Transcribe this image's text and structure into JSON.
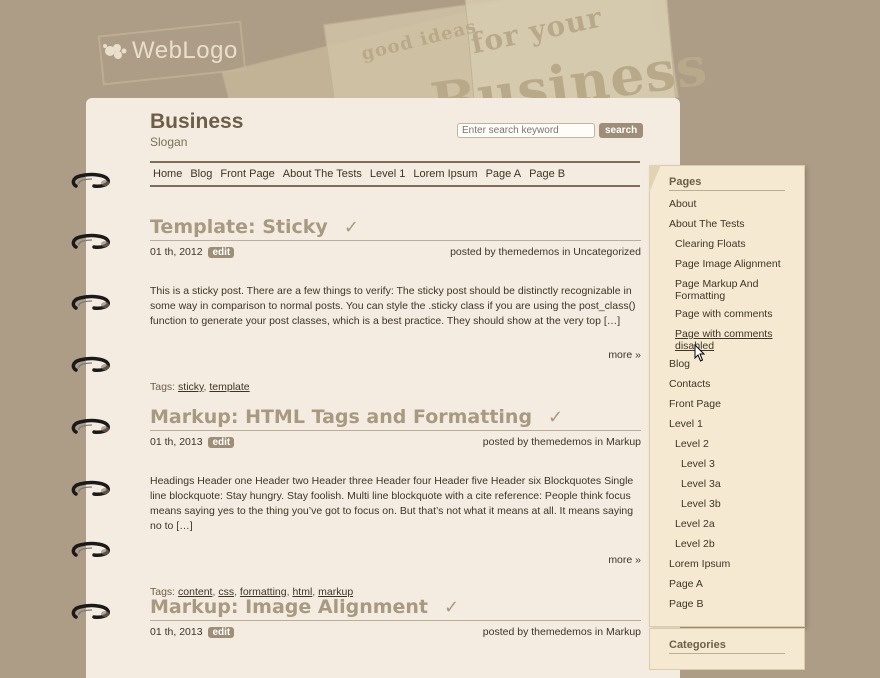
{
  "logo": {
    "text": "WebLogo"
  },
  "header_words": {
    "w1": "Business",
    "w2": "for your",
    "w3": "good ideas"
  },
  "site": {
    "title": "Business",
    "slogan": "Slogan"
  },
  "search": {
    "placeholder": "Enter search keyword",
    "button": "search"
  },
  "nav": [
    "Home",
    "Blog",
    "Front Page",
    "About The Tests",
    "Level 1",
    "Lorem Ipsum",
    "Page A",
    "Page B"
  ],
  "common": {
    "edit": "edit",
    "posted_by": "posted by",
    "in": "in",
    "more": "more »",
    "tags_label": "Tags:"
  },
  "posts": [
    {
      "title": "Template: Sticky",
      "date": "01 th, 2012",
      "author": "themedemos",
      "category": "Uncategorized",
      "excerpt": "This is a sticky post. There are a few things to verify: The sticky post should be distinctly recognizable in some way in comparison to normal posts. You can style the .sticky class if you are using the post_class() function to generate your post classes, which is a best practice. They should show at the very top […]",
      "tags": [
        "sticky",
        "template"
      ]
    },
    {
      "title": "Markup: HTML Tags and Formatting",
      "date": "01 th, 2013",
      "author": "themedemos",
      "category": "Markup",
      "excerpt": "Headings Header one Header two Header three Header four Header five Header six Blockquotes Single line blockquote: Stay hungry. Stay foolish. Multi line blockquote with a cite reference: People think focus means saying yes to the thing you’ve got to focus on. But that’s not what it means at all. It means saying no to […]",
      "tags": [
        "content",
        "css",
        "formatting",
        "html",
        "markup"
      ]
    },
    {
      "title": "Markup: Image Alignment",
      "date": "01 th, 2013",
      "author": "themedemos",
      "category": "Markup"
    }
  ],
  "sidebar": {
    "pages_heading": "Pages",
    "pages": [
      {
        "label": "About",
        "level": 0
      },
      {
        "label": "About The Tests",
        "level": 0
      },
      {
        "label": "Clearing Floats",
        "level": 1
      },
      {
        "label": "Page Image Alignment",
        "level": 1
      },
      {
        "label": "Page Markup And Formatting",
        "level": 1
      },
      {
        "label": "Page with comments",
        "level": 1
      },
      {
        "label": "Page with comments disabled",
        "level": 1,
        "hover": true
      },
      {
        "label": "Blog",
        "level": 0
      },
      {
        "label": "Contacts",
        "level": 0
      },
      {
        "label": "Front Page",
        "level": 0
      },
      {
        "label": "Level 1",
        "level": 0
      },
      {
        "label": "Level 2",
        "level": 1
      },
      {
        "label": "Level 3",
        "level": 2
      },
      {
        "label": "Level 3a",
        "level": 2
      },
      {
        "label": "Level 3b",
        "level": 2
      },
      {
        "label": "Level 2a",
        "level": 1
      },
      {
        "label": "Level 2b",
        "level": 1
      },
      {
        "label": "Lorem Ipsum",
        "level": 0
      },
      {
        "label": "Page A",
        "level": 0
      },
      {
        "label": "Page B",
        "level": 0
      }
    ],
    "categories_heading": "Categories"
  },
  "colors": {
    "background": "#ad9c86",
    "sheet": "#f4ece0",
    "sidebar": "#f5ead1",
    "accent": "#9e8e77",
    "title": "#a79a80"
  }
}
